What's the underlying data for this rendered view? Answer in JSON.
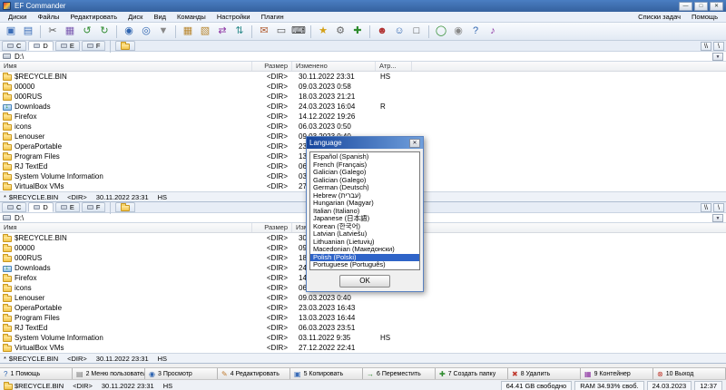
{
  "window": {
    "title": "EF Commander",
    "controls": [
      {
        "name": "minimize",
        "glyph": "—"
      },
      {
        "name": "maximize",
        "glyph": "□"
      },
      {
        "name": "close",
        "glyph": "✕"
      }
    ]
  },
  "menubar": {
    "items": [
      "Диски",
      "Файлы",
      "Редактировать",
      "Диск",
      "Вид",
      "Команды",
      "Настройки",
      "Плагин"
    ],
    "right_items": [
      {
        "label": "Списки задач",
        "name": "menu-task-lists"
      },
      {
        "label": "Помощь",
        "name": "menu-help"
      }
    ]
  },
  "toolbar": {
    "icons": [
      {
        "name": "copy-icon",
        "glyph": "▣",
        "color": "#3a6db8"
      },
      {
        "name": "folders-icon",
        "glyph": "▤",
        "color": "#3a6db8"
      },
      {
        "sep": true
      },
      {
        "name": "cut-icon",
        "glyph": "✂",
        "color": "#555555"
      },
      {
        "name": "paste-icon",
        "glyph": "▦",
        "color": "#7a5ab0"
      },
      {
        "name": "undo-icon",
        "glyph": "↺",
        "color": "#2e8b2e"
      },
      {
        "name": "redo-icon",
        "glyph": "↻",
        "color": "#2e8b2e"
      },
      {
        "sep": true
      },
      {
        "name": "search-icon",
        "glyph": "◉",
        "color": "#2e64b0"
      },
      {
        "name": "zoom-icon",
        "glyph": "◎",
        "color": "#2e64b0"
      },
      {
        "name": "filter-icon",
        "glyph": "▼",
        "color": "#888888"
      },
      {
        "sep": true
      },
      {
        "name": "pack-icon",
        "glyph": "▦",
        "color": "#b8862e"
      },
      {
        "name": "unpack-icon",
        "glyph": "▧",
        "color": "#b8862e"
      },
      {
        "name": "compare-icon",
        "glyph": "⇄",
        "color": "#8a2ea0"
      },
      {
        "name": "sync-icon",
        "glyph": "⇅",
        "color": "#2e8b8b"
      },
      {
        "sep": true
      },
      {
        "name": "mail-icon",
        "glyph": "✉",
        "color": "#b05a2e"
      },
      {
        "name": "print-icon",
        "glyph": "▭",
        "color": "#555555"
      },
      {
        "name": "terminal-icon",
        "glyph": "⌨",
        "color": "#333333"
      },
      {
        "sep": true
      },
      {
        "name": "favorites-icon",
        "glyph": "★",
        "color": "#d4a017"
      },
      {
        "name": "settings-icon",
        "glyph": "⚙",
        "color": "#666666"
      },
      {
        "name": "tools-icon",
        "glyph": "✚",
        "color": "#2e8b2e"
      },
      {
        "sep": true
      },
      {
        "name": "users-icon",
        "glyph": "☻",
        "color": "#b02e2e"
      },
      {
        "name": "user-icon",
        "glyph": "☺",
        "color": "#2e64b0"
      },
      {
        "name": "display-icon",
        "glyph": "□",
        "color": "#444444"
      },
      {
        "sep": true
      },
      {
        "name": "world-icon",
        "glyph": "◯",
        "color": "#2e8b2e"
      },
      {
        "name": "cd-icon",
        "glyph": "◉",
        "color": "#888888"
      },
      {
        "name": "help-icon",
        "glyph": "?",
        "color": "#2e64b0"
      },
      {
        "name": "music-icon",
        "glyph": "♪",
        "color": "#8a2ea0"
      }
    ]
  },
  "panel": {
    "drive_tabs": [
      {
        "letter": "C",
        "active": false
      },
      {
        "letter": "D",
        "active": true
      },
      {
        "letter": "E",
        "active": false
      },
      {
        "letter": "F",
        "active": false
      }
    ],
    "path": "D:\\",
    "dropdown_glyph": "▼",
    "header_buttons": [
      "\\\\",
      "\\"
    ],
    "columns": [
      "Имя",
      "Размер",
      "Изменено",
      "Атр..."
    ],
    "rows": [
      {
        "icon": "folder",
        "name": "$RECYCLE.BIN",
        "size": "<DIR>",
        "modified": "30.11.2022 23:31",
        "attr": "HS"
      },
      {
        "icon": "folder",
        "name": "00000",
        "size": "<DIR>",
        "modified": "09.03.2023 0:58",
        "attr": ""
      },
      {
        "icon": "folder",
        "name": "000RUS",
        "size": "<DIR>",
        "modified": "18.03.2023 21:21",
        "attr": ""
      },
      {
        "icon": "downloads",
        "name": "Downloads",
        "size": "<DIR>",
        "modified": "24.03.2023 16:04",
        "attr": "R"
      },
      {
        "icon": "folder",
        "name": "Firefox",
        "size": "<DIR>",
        "modified": "14.12.2022 19:26",
        "attr": ""
      },
      {
        "icon": "folder",
        "name": "icons",
        "size": "<DIR>",
        "modified": "06.03.2023 0:50",
        "attr": ""
      },
      {
        "icon": "folder",
        "name": "Lenouser",
        "size": "<DIR>",
        "modified": "09.03.2023 0:40",
        "attr": ""
      },
      {
        "icon": "folder",
        "name": "OperaPortable",
        "size": "<DIR>",
        "modified": "23.03.2023 16:43",
        "attr": ""
      },
      {
        "icon": "folder",
        "name": "Program Files",
        "size": "<DIR>",
        "modified": "13.03.2023 16:44",
        "attr": ""
      },
      {
        "icon": "folder",
        "name": "RJ TextEd",
        "size": "<DIR>",
        "modified": "06.03.2023 23:51",
        "attr": ""
      },
      {
        "icon": "folder",
        "name": "System Volume Information",
        "size": "<DIR>",
        "modified": "03.11.2022 9:35",
        "attr": "HS"
      },
      {
        "icon": "folder",
        "name": "VirtualBox VMs",
        "size": "<DIR>",
        "modified": "27.12.2022 22:41",
        "attr": ""
      }
    ],
    "status": {
      "prefix": "*",
      "name": "$RECYCLE.BIN",
      "size": "<DIR>",
      "modified": "30.11.2022 23:31",
      "attr": "HS"
    }
  },
  "dialog": {
    "title": "Language",
    "close_glyph": "✕",
    "languages": [
      "Español (Spanish)",
      "French (Français)",
      "Galician (Galego)",
      "Galician (Galego)",
      "German (Deutsch)",
      "Hebrew (עברית)",
      "Hungarian (Magyar)",
      "Italian (Italiano)",
      "Japanese (日本語)",
      "Korean (한국어)",
      "Latvian (Latviešu)",
      "Lithuanian (Lietuvių)",
      "Macedonian (Македонски)",
      "Polish (Polski)",
      "Portuguese (Português)"
    ],
    "selected_index": 13,
    "ok_label": "OK"
  },
  "funcbar": {
    "buttons": [
      {
        "key": "1",
        "label": "Помощь",
        "icon": "help",
        "glyph": "?",
        "color": "#2e64b0"
      },
      {
        "key": "2",
        "label": "Меню пользователя",
        "icon": "user-menu",
        "glyph": "▤",
        "color": "#777777"
      },
      {
        "key": "3",
        "label": "Просмотр",
        "icon": "view",
        "glyph": "◉",
        "color": "#2e64b0"
      },
      {
        "key": "4",
        "label": "Редактировать",
        "icon": "edit",
        "glyph": "✎",
        "color": "#c07a2e"
      },
      {
        "key": "5",
        "label": "Копировать",
        "icon": "copy",
        "glyph": "▣",
        "color": "#3a6db8"
      },
      {
        "key": "6",
        "label": "Переместить",
        "icon": "move",
        "glyph": "→",
        "color": "#2e8b2e"
      },
      {
        "key": "7",
        "label": "Создать папку",
        "icon": "new-folder",
        "glyph": "✚",
        "color": "#2e8b2e"
      },
      {
        "key": "8",
        "label": "Удалить",
        "icon": "delete",
        "glyph": "✖",
        "color": "#c03a2e"
      },
      {
        "key": "9",
        "label": "Контейнер",
        "icon": "container",
        "glyph": "▦",
        "color": "#8a2ea0"
      },
      {
        "key": "10",
        "label": "Выход",
        "icon": "exit",
        "glyph": "⊗",
        "color": "#c03a2e"
      }
    ]
  },
  "statusbar": {
    "file": {
      "name": "$RECYCLE.BIN",
      "size": "<DIR>",
      "modified": "30.11.2022 23:31",
      "attr": "HS"
    },
    "segments": [
      "64.41 GB свободно",
      "RAM 34.93% своб.",
      "24.03.2023",
      "12:37"
    ]
  }
}
